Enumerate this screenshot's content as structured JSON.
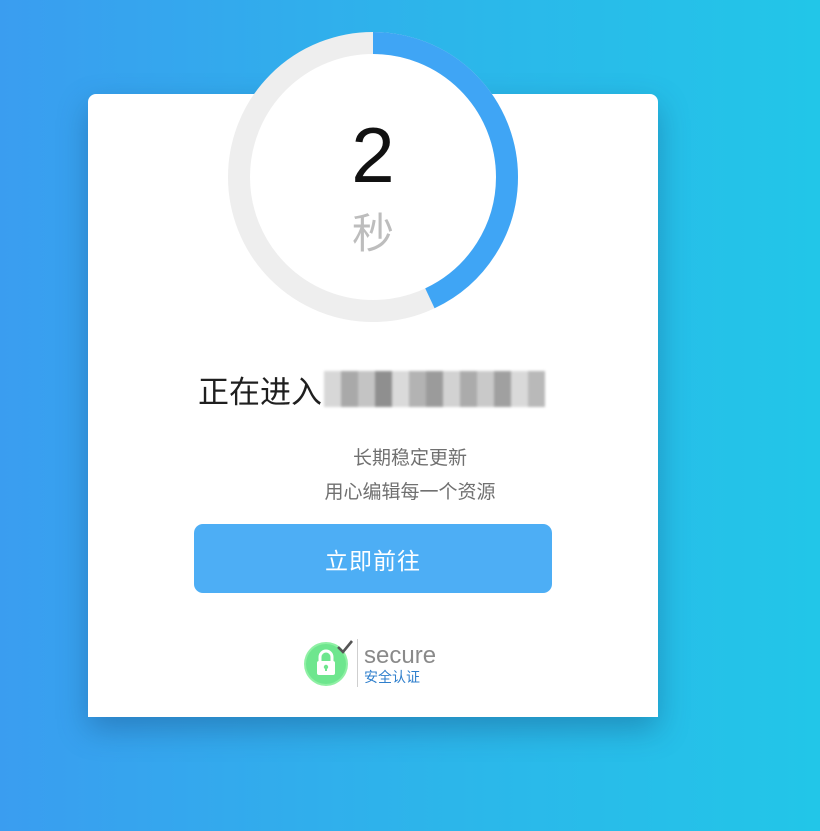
{
  "countdown": {
    "value": "2",
    "unit": "秒",
    "progress_fraction": 0.43,
    "track_color": "#eeeeee",
    "progress_color": "#3fa5f5"
  },
  "heading": {
    "text": "正在进入"
  },
  "tagline": {
    "line1": "长期稳定更新",
    "line2": "用心编辑每一个资源"
  },
  "go_button": {
    "label": "立即前往",
    "color": "#4daef5"
  },
  "secure_badge": {
    "word": "secure",
    "sub": "安全认证",
    "icon": "lock-icon",
    "check_icon": "checkmark-icon"
  }
}
